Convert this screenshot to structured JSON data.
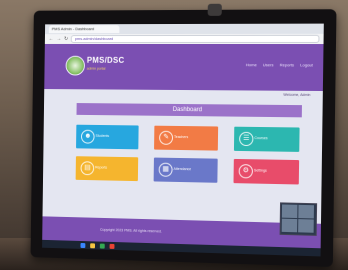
{
  "browser": {
    "tab_title": "PMS Admin - Dashboard",
    "url": "pms.admin/dashboard"
  },
  "site": {
    "logo_title": "PMS/DSC",
    "logo_subtitle": "admin portal",
    "nav_items": [
      "Home",
      "Users",
      "Reports",
      "Logout"
    ],
    "welcome_text": "Welcome, Admin"
  },
  "dashboard": {
    "banner_title": "Dashboard",
    "tiles": [
      {
        "label": "Students",
        "color": "#27a7df",
        "icon": "users-icon"
      },
      {
        "label": "Teachers",
        "color": "#f27b45",
        "icon": "teacher-icon"
      },
      {
        "label": "Courses",
        "color": "#2cb7b0",
        "icon": "book-icon"
      },
      {
        "label": "Reports",
        "color": "#f5b52e",
        "icon": "report-icon"
      },
      {
        "label": "Attendance",
        "color": "#6a78c9",
        "icon": "calendar-icon"
      },
      {
        "label": "Settings",
        "color": "#e84c6a",
        "icon": "gear-icon"
      }
    ]
  },
  "footer": {
    "text": "Copyright 2023 PMS. All rights reserved."
  },
  "colors": {
    "header_purple": "#7b4fb2",
    "banner_purple": "#9b72c9",
    "page_bg": "#e4e6f1"
  }
}
